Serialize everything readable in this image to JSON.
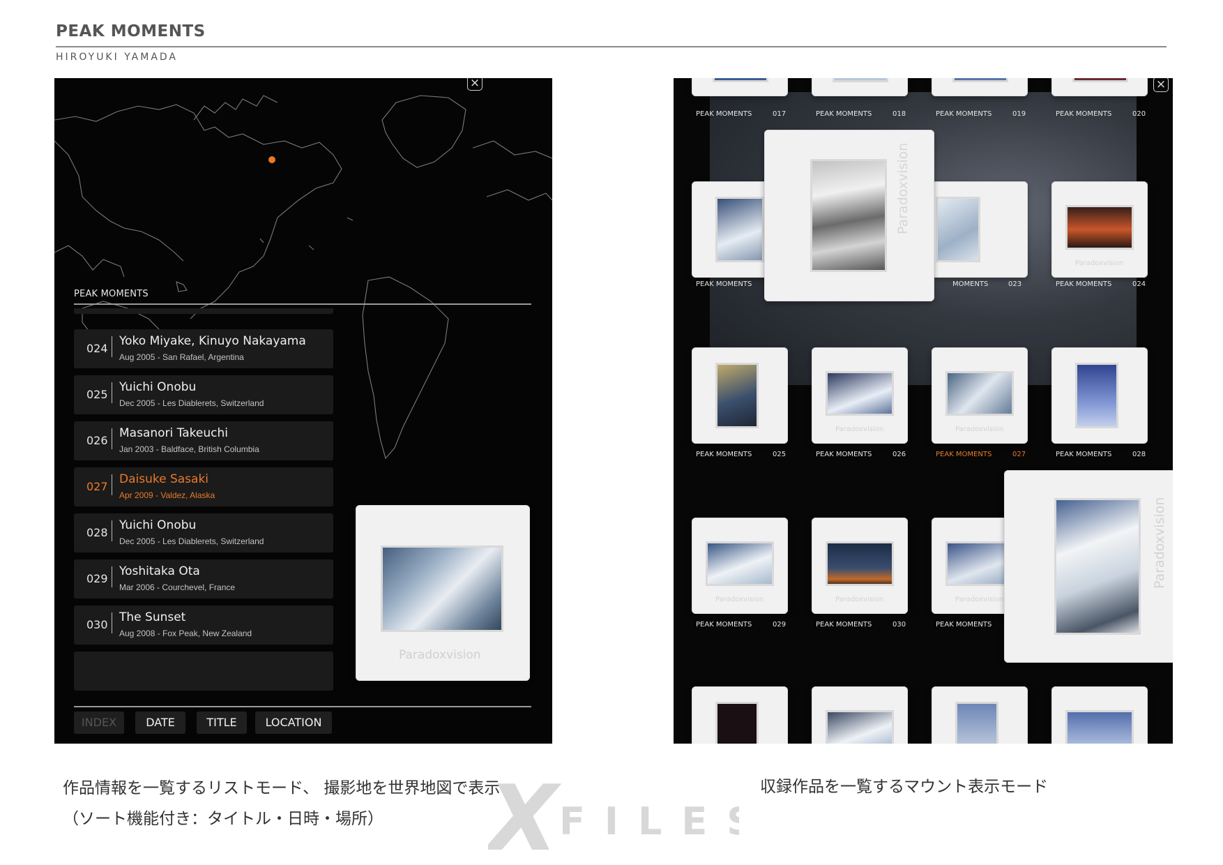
{
  "doc": {
    "title": "PEAK MOMENTS",
    "author": "HIROYUKI YAMADA"
  },
  "list_mode": {
    "list_header": "PEAK MOMENTS",
    "close_icon": "close-icon",
    "rows": [
      {
        "num": "024",
        "name": "Yoko Miyake, Kinuyo Nakayama",
        "detail": "Aug 2005 - San Rafael, Argentina",
        "active": false
      },
      {
        "num": "025",
        "name": "Yuichi Onobu",
        "detail": "Dec 2005 - Les Diablerets, Switzerland",
        "active": false
      },
      {
        "num": "026",
        "name": "Masanori Takeuchi",
        "detail": "Jan 2003 - Baldface, British Columbia",
        "active": false
      },
      {
        "num": "027",
        "name": "Daisuke Sasaki",
        "detail": "Apr 2009 - Valdez, Alaska",
        "active": true
      },
      {
        "num": "028",
        "name": "Yuichi Onobu",
        "detail": "Dec 2005 - Les Diablerets, Switzerland",
        "active": false
      },
      {
        "num": "029",
        "name": "Yoshitaka Ota",
        "detail": "Mar 2006 - Courchevel, France",
        "active": false
      },
      {
        "num": "030",
        "name": "The Sunset",
        "detail": "Aug 2008 - Fox Peak, New Zealand",
        "active": false
      }
    ],
    "sort_buttons": [
      {
        "label": "INDEX",
        "disabled": true
      },
      {
        "label": "DATE",
        "disabled": false
      },
      {
        "label": "TITLE",
        "disabled": false
      },
      {
        "label": "LOCATION",
        "disabled": false
      }
    ],
    "preview_mount_label": "Paradoxvision",
    "map_marker_color": "#ea7a2a"
  },
  "mount_mode": {
    "mount_label": "Paradoxvision",
    "series_label": "PEAK MOMENTS",
    "captions": [
      {
        "title": "PEAK MOMENTS",
        "num": "017",
        "active": false
      },
      {
        "title": "PEAK MOMENTS",
        "num": "018",
        "active": false
      },
      {
        "title": "PEAK MOMENTS",
        "num": "019",
        "active": false
      },
      {
        "title": "PEAK MOMENTS",
        "num": "020",
        "active": false
      },
      {
        "title": "PEAK MOMENTS",
        "num": "",
        "active": false
      },
      {
        "title": "MOMENTS",
        "num": "023",
        "active": false
      },
      {
        "title": "PEAK MOMENTS",
        "num": "024",
        "active": false
      },
      {
        "title": "PEAK MOMENTS",
        "num": "025",
        "active": false
      },
      {
        "title": "PEAK MOMENTS",
        "num": "026",
        "active": false
      },
      {
        "title": "PEAK MOMENTS",
        "num": "027",
        "active": true
      },
      {
        "title": "PEAK MOMENTS",
        "num": "028",
        "active": false
      },
      {
        "title": "PEAK MOMENTS",
        "num": "029",
        "active": false
      },
      {
        "title": "PEAK MOMENTS",
        "num": "030",
        "active": false
      },
      {
        "title": "PEAK MOMENTS",
        "num": "",
        "active": false
      }
    ],
    "accent_color": "#ea7a2a"
  },
  "captions": {
    "left_line1": "作品情報を一覧するリストモード、 撮影地を世界地図で表示",
    "left_line2": "（ソート機能付き：タイトル・日時・場所）",
    "right": "収録作品を一覧するマウント表示モード"
  },
  "watermark": {
    "letter": "X",
    "word": "FILES"
  }
}
